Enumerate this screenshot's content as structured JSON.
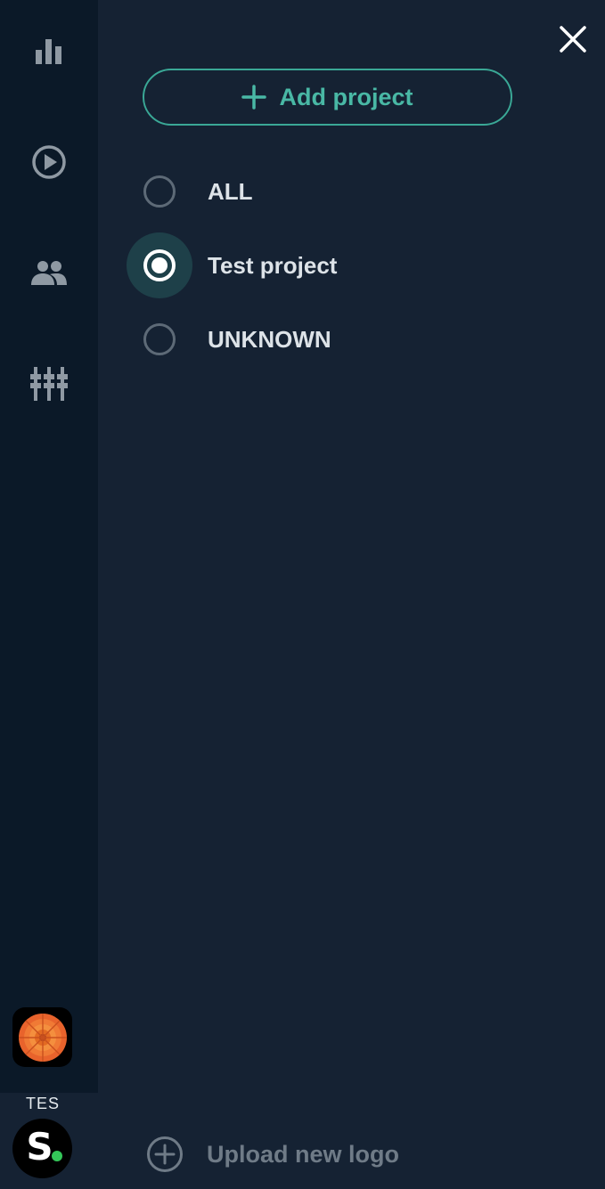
{
  "sidebar": {
    "items": [
      {
        "icon": "bar-chart-icon"
      },
      {
        "icon": "play-circle-icon"
      },
      {
        "icon": "people-icon"
      },
      {
        "icon": "sliders-icon"
      }
    ],
    "avatar": {
      "icon": "flower-avatar-icon"
    },
    "tenant": {
      "label": "TES",
      "logo_letter": "S",
      "status_color": "#34c759"
    }
  },
  "panel": {
    "close": {
      "icon": "close-icon"
    },
    "add_project_label": "Add project",
    "projects": [
      {
        "label": "ALL",
        "selected": false
      },
      {
        "label": "Test project",
        "selected": true
      },
      {
        "label": "UNKNOWN",
        "selected": false
      }
    ],
    "upload_logo_label": "Upload new logo"
  },
  "colors": {
    "background": "#152233",
    "rail": "#0b1928",
    "accent": "#49b8a5",
    "selected_halo": "#1e4049"
  }
}
